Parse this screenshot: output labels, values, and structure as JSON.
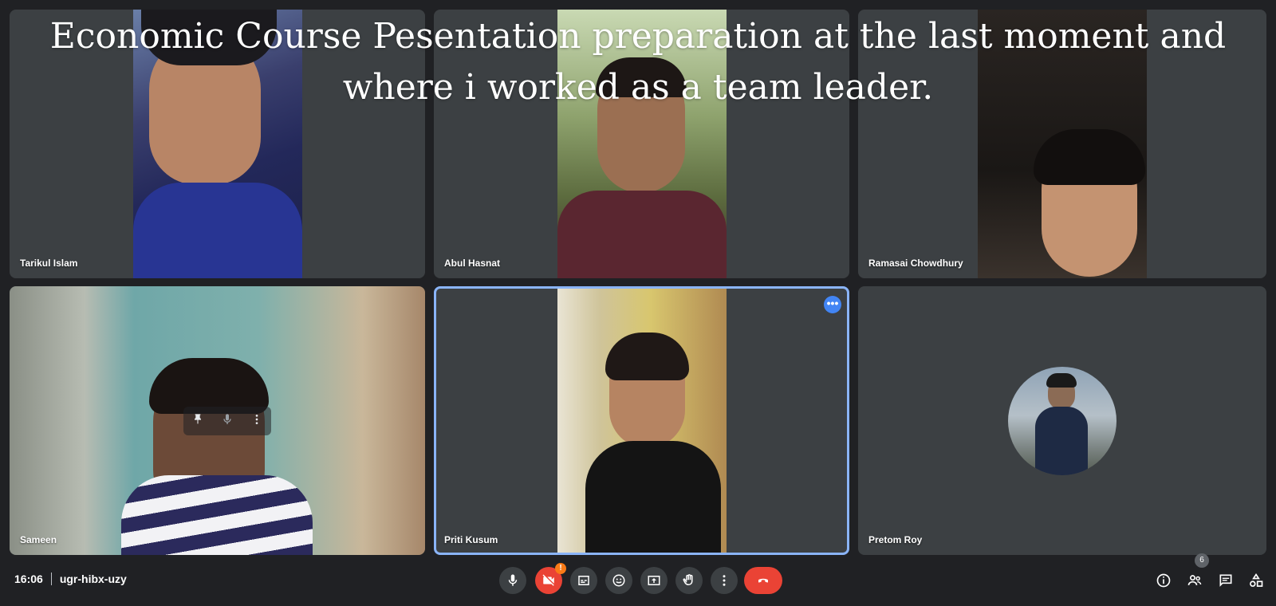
{
  "caption": "Economic Course Pesentation preparation at the last moment and where i worked as a team leader.",
  "participants": [
    {
      "name": "Tarikul Islam"
    },
    {
      "name": "Abul Hasnat"
    },
    {
      "name": "Ramasai Chowdhury"
    },
    {
      "name": "Sameen"
    },
    {
      "name": "Priti Kusum"
    },
    {
      "name": "Pretom Roy"
    }
  ],
  "meeting": {
    "time": "16:06",
    "code": "ugr-hibx-uzy"
  },
  "participant_count": "6",
  "icons": {
    "more": "more-options-icon",
    "mic": "microphone-icon",
    "camera_off": "camera-off-icon",
    "captions": "captions-icon",
    "emoji": "emoji-icon",
    "present": "present-screen-icon",
    "hand": "raise-hand-icon",
    "more_vert": "more-vert-icon",
    "end_call": "end-call-icon",
    "info": "info-icon",
    "people": "people-icon",
    "chat": "chat-icon",
    "activities": "activities-icon",
    "pin": "pin-icon"
  },
  "colors": {
    "background": "#202124",
    "tile": "#3c4043",
    "accent": "#8ab4f8",
    "end_call": "#ea4335",
    "warning": "#fa7b17"
  }
}
